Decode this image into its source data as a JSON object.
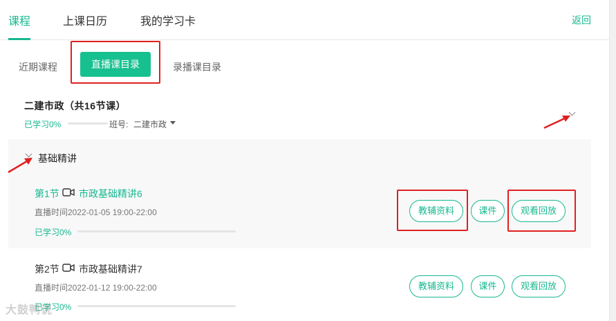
{
  "topnav": {
    "tabs": [
      {
        "label": "课程"
      },
      {
        "label": "上课日历"
      },
      {
        "label": "我的学习卡"
      }
    ],
    "back_label": "返回",
    "accent": "#17b890"
  },
  "subtabs": {
    "recent_label": "近期课程",
    "live_label": "直播课目录",
    "recorded_label": "录播课目录"
  },
  "course": {
    "title": "二建市政（共16节课）",
    "progress_label": "已学习0%",
    "progress": 0,
    "class_label": "班号:",
    "class_value": "二建市政"
  },
  "section": {
    "title": "基础精讲"
  },
  "lessons": [
    {
      "index_label": "第1节",
      "title": "市政基础精讲6",
      "time": "直播时间2022-01-05 19:00-22:00",
      "progress_label": "已学习0%",
      "progress": 0,
      "buttons": {
        "materials": "教辅资料",
        "courseware": "课件",
        "replay": "观看回放"
      }
    },
    {
      "index_label": "第2节",
      "title": "市政基础精讲7",
      "time": "直播时间2022-01-12 19:00-22:00",
      "progress_label": "已学习0%",
      "progress": 0,
      "buttons": {
        "materials": "教辅资料",
        "courseware": "课件",
        "replay": "观看回放"
      }
    }
  ],
  "watermark": "大鼓鸭说",
  "annotation_color": "#e02020"
}
